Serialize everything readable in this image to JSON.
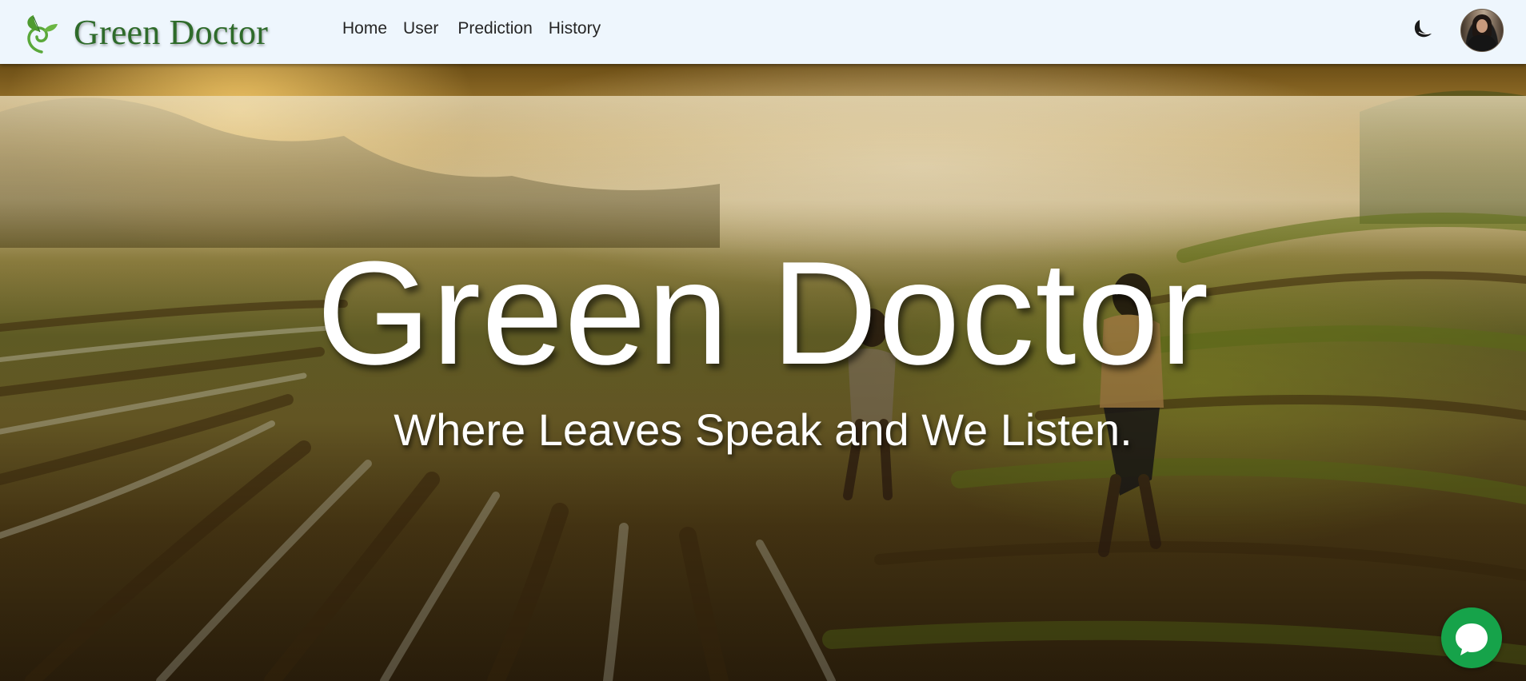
{
  "header": {
    "brand": "Green Doctor",
    "nav": [
      {
        "label": "Home"
      },
      {
        "label": "User"
      },
      {
        "label": "Prediction"
      },
      {
        "label": "History"
      }
    ]
  },
  "hero": {
    "title": "Green Doctor",
    "subtitle": "Where Leaves Speak and We Listen."
  },
  "icons": {
    "logo": "sprout-logo-icon",
    "theme_toggle": "moon-icon",
    "avatar": "user-avatar",
    "chat": "chat-bubble-icon"
  },
  "colors": {
    "brand_green": "#2e6b2a",
    "navbar_bg": "#eef6fd",
    "chat_green": "#16a34a"
  }
}
